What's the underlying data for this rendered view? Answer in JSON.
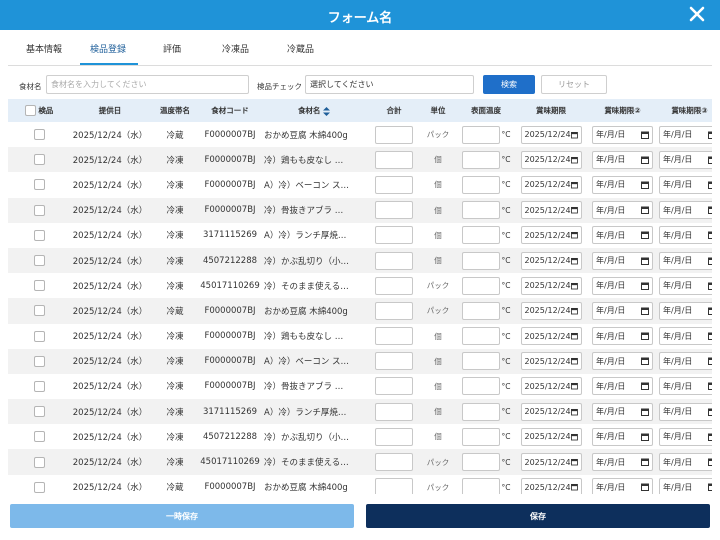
{
  "window": {
    "title": "フォーム名"
  },
  "tabs": [
    {
      "label": "基本情報",
      "active": false
    },
    {
      "label": "検品登録",
      "active": true
    },
    {
      "label": "評価",
      "active": false
    },
    {
      "label": "冷凍品",
      "active": false
    },
    {
      "label": "冷蔵品",
      "active": false
    }
  ],
  "search": {
    "ingredient_label": "食材名",
    "ingredient_placeholder": "食材名を入力してください",
    "check_label": "検品チェック",
    "check_value": "選択してください",
    "search_button": "検索",
    "reset_button": "リセット"
  },
  "table": {
    "headers": {
      "check": "検品",
      "date": "提供日",
      "temp_zone": "温度帯名",
      "code": "食材コード",
      "name": "食材名",
      "total": "合計",
      "unit": "単位",
      "surface_temp": "表面温度",
      "expiry1": "賞味期限",
      "expiry2": "賞味期限②",
      "expiry3": "賞味期限③"
    },
    "temp_unit": "°C",
    "date_placeholder": "年/月/日",
    "rows": [
      {
        "date": "2025/12/24（水）",
        "zone": "冷蔵",
        "code": "F0000007BJ",
        "name": "おかめ豆腐 木綿400g",
        "unit": "パック",
        "expiry1": "2025/12/24"
      },
      {
        "date": "2025/12/24（水）",
        "zone": "冷凍",
        "code": "F0000007BJ",
        "name": "冷）鶏もも皮なし …",
        "unit": "個",
        "expiry1": "2025/12/24"
      },
      {
        "date": "2025/12/24（水）",
        "zone": "冷凍",
        "code": "F0000007BJ",
        "name": "A）冷）ベーコン ス…",
        "unit": "個",
        "expiry1": "2025/12/24"
      },
      {
        "date": "2025/12/24（水）",
        "zone": "冷凍",
        "code": "F0000007BJ",
        "name": "冷）骨抜きアブラ …",
        "unit": "個",
        "expiry1": "2025/12/24"
      },
      {
        "date": "2025/12/24（水）",
        "zone": "冷凍",
        "code": "3171115269",
        "name": "A）冷）ランチ厚焼…",
        "unit": "個",
        "expiry1": "2025/12/24"
      },
      {
        "date": "2025/12/24（水）",
        "zone": "冷凍",
        "code": "4507212288",
        "name": "冷）かぶ乱切り（小…",
        "unit": "個",
        "expiry1": "2025/12/24"
      },
      {
        "date": "2025/12/24（水）",
        "zone": "冷凍",
        "code": "45017110269",
        "name": "冷）そのまま使える…",
        "unit": "パック",
        "expiry1": "2025/12/24"
      },
      {
        "date": "2025/12/24（水）",
        "zone": "冷蔵",
        "code": "F0000007BJ",
        "name": "おかめ豆腐 木綿400g",
        "unit": "パック",
        "expiry1": "2025/12/24"
      },
      {
        "date": "2025/12/24（水）",
        "zone": "冷凍",
        "code": "F0000007BJ",
        "name": "冷）鶏もも皮なし …",
        "unit": "個",
        "expiry1": "2025/12/24"
      },
      {
        "date": "2025/12/24（水）",
        "zone": "冷凍",
        "code": "F0000007BJ",
        "name": "A）冷）ベーコン ス…",
        "unit": "個",
        "expiry1": "2025/12/24"
      },
      {
        "date": "2025/12/24（水）",
        "zone": "冷凍",
        "code": "F0000007BJ",
        "name": "冷）骨抜きアブラ …",
        "unit": "個",
        "expiry1": "2025/12/24"
      },
      {
        "date": "2025/12/24（水）",
        "zone": "冷凍",
        "code": "3171115269",
        "name": "A）冷）ランチ厚焼…",
        "unit": "個",
        "expiry1": "2025/12/24"
      },
      {
        "date": "2025/12/24（水）",
        "zone": "冷凍",
        "code": "4507212288",
        "name": "冷）かぶ乱切り（小…",
        "unit": "個",
        "expiry1": "2025/12/24"
      },
      {
        "date": "2025/12/24（水）",
        "zone": "冷凍",
        "code": "45017110269",
        "name": "冷）そのまま使える…",
        "unit": "パック",
        "expiry1": "2025/12/24"
      },
      {
        "date": "2025/12/24（水）",
        "zone": "冷蔵",
        "code": "F0000007BJ",
        "name": "おかめ豆腐 木綿400g",
        "unit": "パック",
        "expiry1": "2025/12/24"
      }
    ]
  },
  "footer": {
    "temp_save": "一時保存",
    "save": "保存"
  },
  "colors": {
    "titlebar": "#1f93d8",
    "header_row": "#e4eef8",
    "save_button": "#0d2f5c",
    "temp_save_button": "#7db9ea"
  }
}
